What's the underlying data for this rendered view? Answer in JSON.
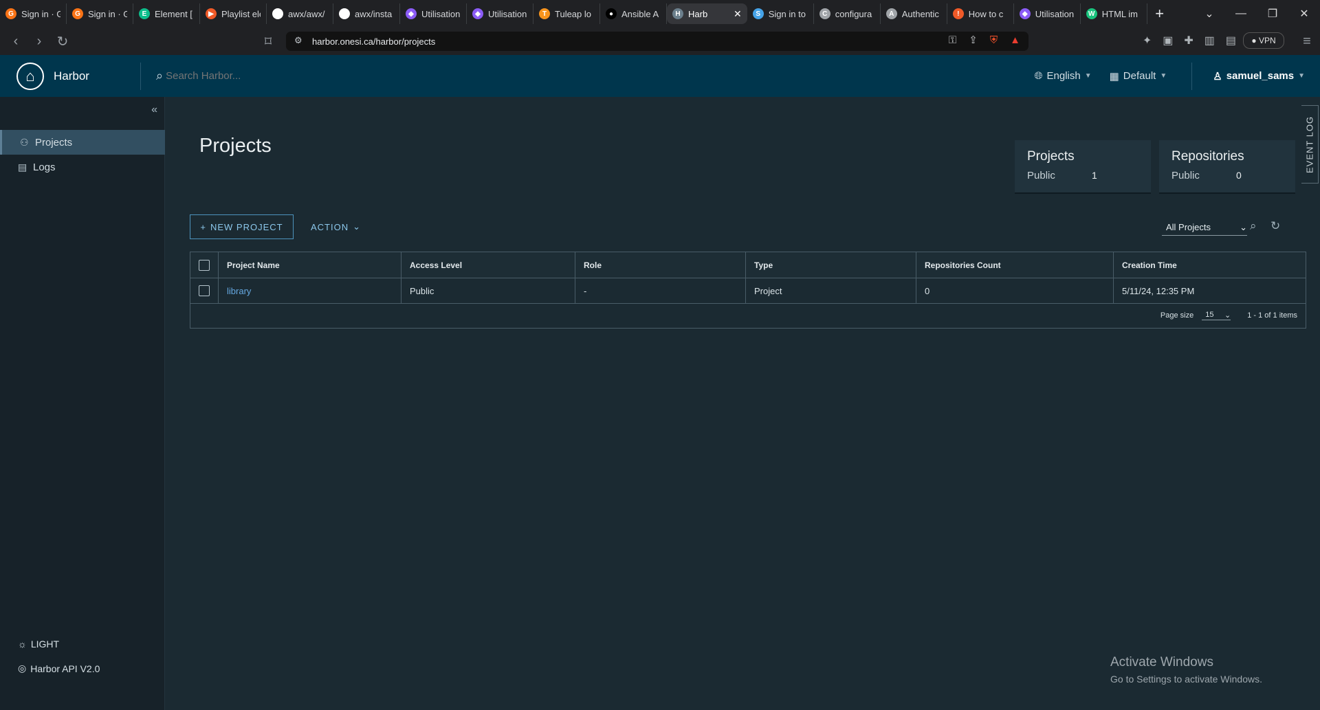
{
  "browser": {
    "tabs": [
      {
        "title": "Sign in · G",
        "fav": "G",
        "color": "#f97316"
      },
      {
        "title": "Sign in · G",
        "fav": "G",
        "color": "#f97316"
      },
      {
        "title": "Element [",
        "fav": "E",
        "color": "#0dbd8b"
      },
      {
        "title": "Playlist ele",
        "fav": "▶",
        "color": "#f05a28"
      },
      {
        "title": "awx/awx/",
        "fav": "●",
        "color": "#ffffff"
      },
      {
        "title": "awx/insta",
        "fav": "●",
        "color": "#ffffff"
      },
      {
        "title": "Utilisation",
        "fav": "◆",
        "color": "#8b5cf6"
      },
      {
        "title": "Utilisation",
        "fav": "◆",
        "color": "#8b5cf6"
      },
      {
        "title": "Tuleap lo",
        "fav": "T",
        "color": "#f7941d"
      },
      {
        "title": "Ansible A",
        "fav": "●",
        "color": "#000000"
      },
      {
        "title": "Harb",
        "fav": "H",
        "color": "#6b7f8c",
        "active": true
      },
      {
        "title": "Sign in to",
        "fav": "S",
        "color": "#45a3e8"
      },
      {
        "title": "configura",
        "fav": "C",
        "color": "#a0a4a8"
      },
      {
        "title": "Authentic",
        "fav": "A",
        "color": "#a0a4a8"
      },
      {
        "title": "How to c",
        "fav": "!",
        "color": "#f05a28"
      },
      {
        "title": "Utilisation",
        "fav": "◆",
        "color": "#8b5cf6"
      },
      {
        "title": "HTML im",
        "fav": "W",
        "color": "#19c37d"
      }
    ],
    "url": "harbor.onesi.ca/harbor/projects",
    "vpn": "VPN"
  },
  "app": {
    "brand": "Harbor",
    "search_placeholder": "Search Harbor...",
    "language": "English",
    "theme_menu": "Default",
    "user": "samuel_sams"
  },
  "sidebar": {
    "items": [
      {
        "label": "Projects",
        "icon": "project-icon",
        "active": true
      },
      {
        "label": "Logs",
        "icon": "logs-icon"
      }
    ],
    "bottom": [
      {
        "label": "LIGHT",
        "icon": "sun-icon"
      },
      {
        "label": "Harbor API V2.0",
        "icon": "api-icon"
      }
    ]
  },
  "main": {
    "title": "Projects",
    "event_log": "EVENT LOG",
    "stats": [
      {
        "title": "Projects",
        "label": "Public",
        "value": "1"
      },
      {
        "title": "Repositories",
        "label": "Public",
        "value": "0"
      }
    ],
    "new_project": "NEW PROJECT",
    "action": "ACTION",
    "filter": "All Projects",
    "table": {
      "headers": [
        "Project Name",
        "Access Level",
        "Role",
        "Type",
        "Repositories Count",
        "Creation Time"
      ],
      "rows": [
        [
          "library",
          "Public",
          "-",
          "Project",
          "0",
          "5/11/24, 12:35 PM"
        ]
      ],
      "page_size_label": "Page size",
      "page_size": "15",
      "summary": "1 - 1 of 1 items"
    }
  },
  "windows": {
    "line1": "Activate Windows",
    "line2": "Go to Settings to activate Windows."
  }
}
